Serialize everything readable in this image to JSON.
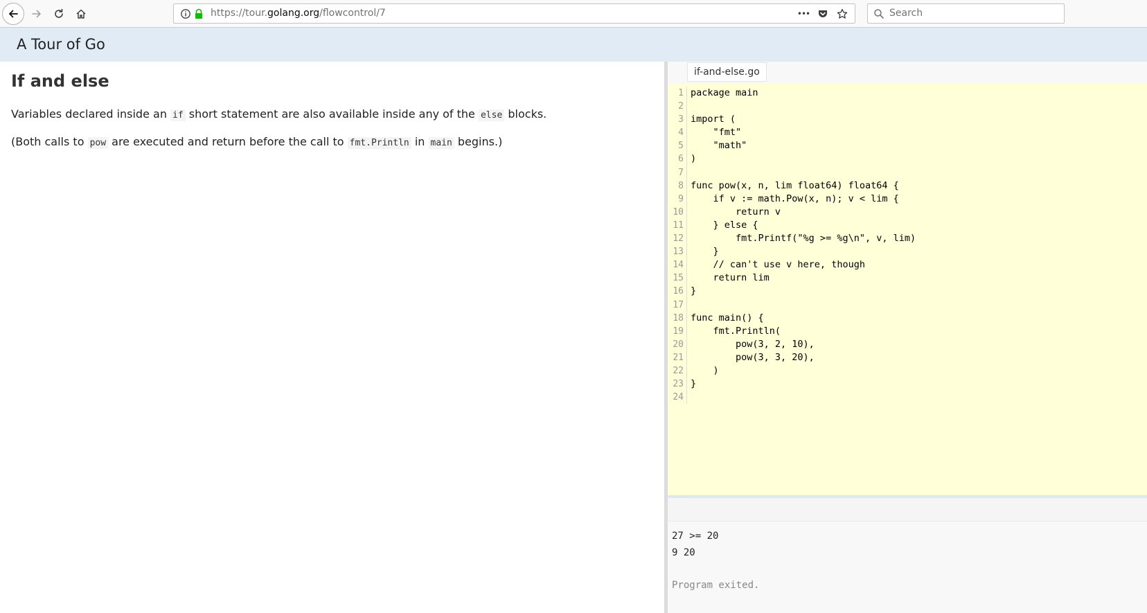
{
  "browser": {
    "url_prefix": "https://tour.",
    "url_host": "golang.org",
    "url_path": "/flowcontrol/7",
    "search_placeholder": "Search",
    "more_label": "•••"
  },
  "tour": {
    "header_title": "A Tour of Go"
  },
  "lesson": {
    "title": "If and else",
    "para1": {
      "t1": "Variables declared inside an ",
      "c1": "if",
      "t2": " short statement are also available inside any of the ",
      "c2": "else",
      "t3": " blocks."
    },
    "para2": {
      "t1": "(Both calls to ",
      "c1": "pow",
      "t2": " are executed and return before the call to ",
      "c2": "fmt.Println",
      "t3": " in ",
      "c3": "main",
      "t4": " begins.)"
    }
  },
  "editor": {
    "filename": "if-and-else.go",
    "line_numbers": [
      "1",
      "2",
      "3",
      "4",
      "5",
      "6",
      "7",
      "8",
      "9",
      "10",
      "11",
      "12",
      "13",
      "14",
      "15",
      "16",
      "17",
      "18",
      "19",
      "20",
      "21",
      "22",
      "23",
      "24"
    ],
    "lines": [
      "package main",
      "",
      "import (",
      "    \"fmt\"",
      "    \"math\"",
      ")",
      "",
      "func pow(x, n, lim float64) float64 {",
      "    if v := math.Pow(x, n); v < lim {",
      "        return v",
      "    } else {",
      "        fmt.Printf(\"%g >= %g\\n\", v, lim)",
      "    }",
      "    // can't use v here, though",
      "    return lim",
      "}",
      "",
      "func main() {",
      "    fmt.Println(",
      "        pow(3, 2, 10),",
      "        pow(3, 3, 20),",
      "    )",
      "}",
      ""
    ]
  },
  "output": {
    "lines": [
      "27 >= 20",
      "9 20"
    ],
    "exited": "Program exited."
  }
}
